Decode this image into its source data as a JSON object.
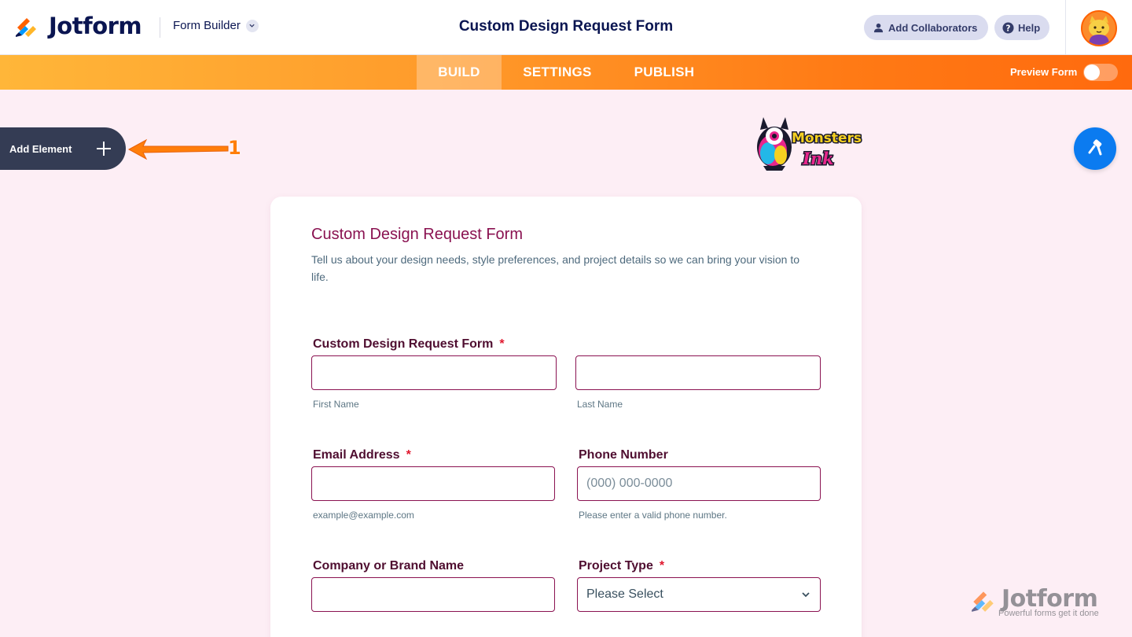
{
  "header": {
    "brand": "Jotform",
    "builder_menu": "Form Builder",
    "title": "Custom Design Request Form",
    "collaborators_label": "Add Collaborators",
    "help_label": "Help"
  },
  "nav": {
    "tabs": [
      {
        "label": "BUILD",
        "active": true
      },
      {
        "label": "SETTINGS",
        "active": false
      },
      {
        "label": "PUBLISH",
        "active": false
      }
    ],
    "preview_label": "Preview Form",
    "preview_on": false
  },
  "sidebar": {
    "add_element_label": "Add Element"
  },
  "annotation": {
    "number": "1"
  },
  "form": {
    "title": "Custom Design Request Form",
    "description": "Tell us about your design needs, style preferences, and project details so we can bring your vision to life.",
    "name_question": {
      "label": "Custom Design Request Form",
      "required": "*",
      "first_sublabel": "First Name",
      "last_sublabel": "Last Name",
      "first_value": "",
      "last_value": ""
    },
    "email_question": {
      "label": "Email Address",
      "required": "*",
      "value": "",
      "sublabel": "example@example.com"
    },
    "phone_question": {
      "label": "Phone Number",
      "placeholder": "(000) 000-0000",
      "sublabel": "Please enter a valid phone number."
    },
    "company_question": {
      "label": "Company or Brand Name",
      "value": ""
    },
    "project_type_question": {
      "label": "Project Type",
      "required": "*",
      "selected": "Please Select"
    }
  },
  "watermark": {
    "brand": "Jotform",
    "tagline": "Powerful forms get it done"
  },
  "colors": {
    "accent_orange": "#ff6100",
    "form_title": "#8a1251",
    "background": "#fdeef5",
    "navy": "#0a1551",
    "paint_button": "#0b7bf0"
  },
  "icons": [
    "jotform-logo-icon",
    "chevron-down-icon",
    "user-icon",
    "help-icon",
    "plus-icon",
    "arrow-annotation-icon",
    "paint-roller-icon",
    "monsters-ink-logo"
  ]
}
